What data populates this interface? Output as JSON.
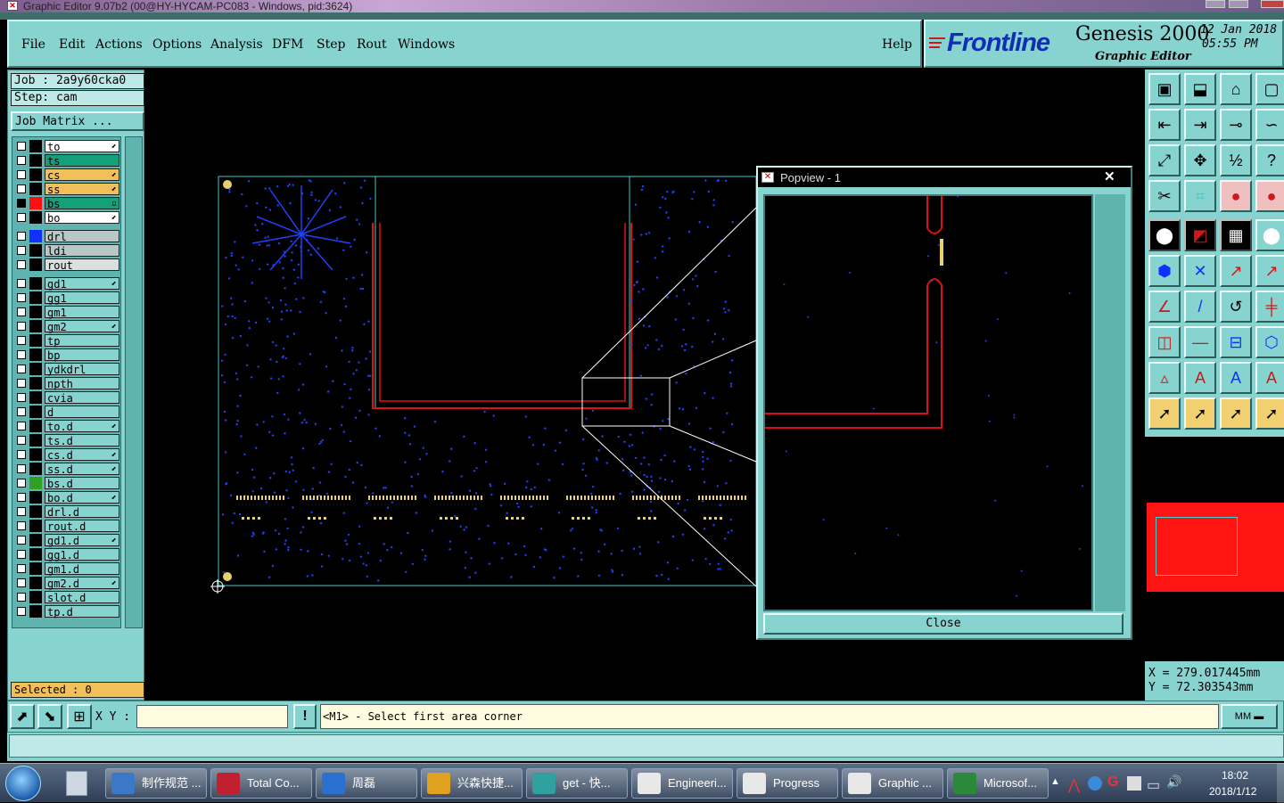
{
  "window": {
    "title": "Graphic Editor 9.07b2 (00@HY-HYCAM-PC083 - Windows, pid:3624)"
  },
  "menu": {
    "file": "File",
    "edit": "Edit",
    "actions": "Actions",
    "options": "Options",
    "analysis": "Analysis",
    "dfm": "DFM",
    "step": "Step",
    "rout": "Rout",
    "windows": "Windows",
    "help": "Help"
  },
  "brand": {
    "logo": "Frontline",
    "product": "Genesis 2000",
    "subtitle": "Graphic Editor",
    "date": "12 Jan 2018",
    "time": "05:55 PM"
  },
  "job": {
    "job_label": "Job : 2a9y60cka0",
    "step_label": "Step: cam",
    "matrix_button": "Job Matrix ..."
  },
  "layers": [
    {
      "name": "to",
      "bg": "#ffffff",
      "color": "#000000",
      "mark": "⬋"
    },
    {
      "name": "ts",
      "bg": "#15a07a",
      "color": "#000000",
      "mark": ""
    },
    {
      "name": "cs",
      "bg": "#f2c05a",
      "color": "#000000",
      "mark": "⬋"
    },
    {
      "name": "ss",
      "bg": "#f2c05a",
      "color": "#000000",
      "mark": "⬋"
    },
    {
      "name": "bs",
      "bg": "#15a07a",
      "color": "#ff1010",
      "mark": "▫",
      "checked": true
    },
    {
      "name": "bo",
      "bg": "#ffffff",
      "color": "#000000",
      "mark": "⬋"
    },
    {
      "name": "drl",
      "bg": "#b8c8c8",
      "color": "#1030ff",
      "mark": ""
    },
    {
      "name": "ldi",
      "bg": "#b8c8c8",
      "color": "#000000",
      "mark": ""
    },
    {
      "name": "rout",
      "bg": "#d8e0e0",
      "color": "#000000",
      "mark": ""
    },
    {
      "name": "gd1",
      "bg": "#86d3d0",
      "color": "#000000",
      "mark": "⬋"
    },
    {
      "name": "gg1",
      "bg": "#86d3d0",
      "color": "#000000",
      "mark": ""
    },
    {
      "name": "gm1",
      "bg": "#86d3d0",
      "color": "#000000",
      "mark": ""
    },
    {
      "name": "gm2",
      "bg": "#86d3d0",
      "color": "#000000",
      "mark": "⬋"
    },
    {
      "name": "tp",
      "bg": "#86d3d0",
      "color": "#000000",
      "mark": ""
    },
    {
      "name": "bp",
      "bg": "#86d3d0",
      "color": "#000000",
      "mark": ""
    },
    {
      "name": "ydkdrl",
      "bg": "#86d3d0",
      "color": "#000000",
      "mark": ""
    },
    {
      "name": "npth",
      "bg": "#86d3d0",
      "color": "#000000",
      "mark": ""
    },
    {
      "name": "cvia",
      "bg": "#86d3d0",
      "color": "#000000",
      "mark": ""
    },
    {
      "name": "d",
      "bg": "#86d3d0",
      "color": "#000000",
      "mark": ""
    },
    {
      "name": "to.d",
      "bg": "#86d3d0",
      "color": "#000000",
      "mark": "⬋"
    },
    {
      "name": "ts.d",
      "bg": "#86d3d0",
      "color": "#000000",
      "mark": ""
    },
    {
      "name": "cs.d",
      "bg": "#86d3d0",
      "color": "#000000",
      "mark": "⬋"
    },
    {
      "name": "ss.d",
      "bg": "#86d3d0",
      "color": "#000000",
      "mark": "⬋"
    },
    {
      "name": "bs.d",
      "bg": "#86d3d0",
      "color": "#2fa020",
      "mark": ""
    },
    {
      "name": "bo.d",
      "bg": "#86d3d0",
      "color": "#000000",
      "mark": "⬋"
    },
    {
      "name": "drl.d",
      "bg": "#86d3d0",
      "color": "#000000",
      "mark": ""
    },
    {
      "name": "rout.d",
      "bg": "#86d3d0",
      "color": "#000000",
      "mark": ""
    },
    {
      "name": "gd1.d",
      "bg": "#86d3d0",
      "color": "#000000",
      "mark": "⬋"
    },
    {
      "name": "gg1.d",
      "bg": "#86d3d0",
      "color": "#000000",
      "mark": ""
    },
    {
      "name": "gm1.d",
      "bg": "#86d3d0",
      "color": "#000000",
      "mark": ""
    },
    {
      "name": "gm2.d",
      "bg": "#86d3d0",
      "color": "#000000",
      "mark": "⬋"
    },
    {
      "name": "slot.d",
      "bg": "#86d3d0",
      "color": "#000000",
      "mark": ""
    },
    {
      "name": "tp.d",
      "bg": "#86d3d0",
      "color": "#000000",
      "mark": ""
    }
  ],
  "selected": {
    "label": "Selected : 0"
  },
  "popview": {
    "title": "Popview - 1",
    "close_label": "Close"
  },
  "coords": {
    "x": "X = 279.017445mm",
    "y": "Y = 72.303543mm"
  },
  "command": {
    "xy_label": "X Y :",
    "input_value": "",
    "prompt": "<M1> - Select first area corner",
    "units": "MM"
  },
  "taskbar": {
    "clock_time": "18:02",
    "clock_date": "2018/1/12",
    "tasks": [
      {
        "label": "制作规范 ...",
        "color": "#3c78c8"
      },
      {
        "label": "Total Co...",
        "color": "#c02030"
      },
      {
        "label": "周磊",
        "color": "#2a70d0"
      },
      {
        "label": "兴森快捷...",
        "color": "#e0a020"
      },
      {
        "label": "get - 快...",
        "color": "#30a0a0"
      },
      {
        "label": "Engineeri...",
        "color": "#e8e8e8"
      },
      {
        "label": "Progress",
        "color": "#e8e8e8"
      },
      {
        "label": "Graphic ...",
        "color": "#e8e8e8"
      },
      {
        "label": "Microsof...",
        "color": "#2a8a3a"
      }
    ]
  },
  "colors": {
    "panel": "#86d3d0",
    "outline": "#40c8c8",
    "rout": "#e01010",
    "via": "#2040ff",
    "pad": "#e8d070"
  }
}
